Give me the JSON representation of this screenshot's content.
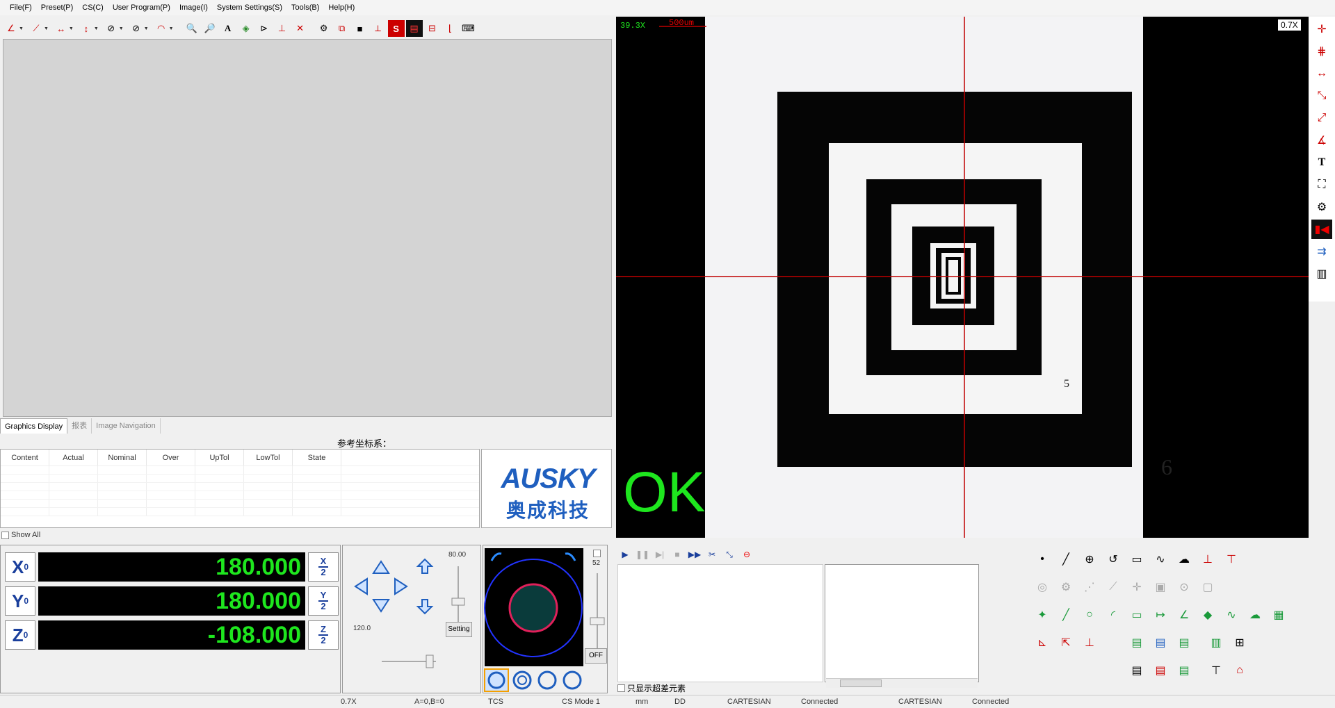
{
  "menu": [
    "File(F)",
    "Preset(P)",
    "CS(C)",
    "User Program(P)",
    "Image(I)",
    "System Settings(S)",
    "Tools(B)",
    "Help(H)"
  ],
  "tabs": [
    "Graphics Display",
    "报表",
    "Image Navigation"
  ],
  "ref_cs_label": "参考坐标系：",
  "result_table": {
    "columns": [
      "Content",
      "Actual",
      "Nominal",
      "Over",
      "UpTol",
      "LowTol",
      "State"
    ]
  },
  "logo": {
    "brand": "AUSKY",
    "cn": "奥成科技"
  },
  "show_all_label": "Show All",
  "dro": [
    {
      "axis": "X",
      "sub": "0",
      "value": "180.000",
      "half": "X",
      "den": "2"
    },
    {
      "axis": "Y",
      "sub": "0",
      "value": "180.000",
      "half": "Y",
      "den": "2"
    },
    {
      "axis": "Z",
      "sub": "0",
      "value": "-108.000",
      "half": "Z",
      "den": "2"
    }
  ],
  "jog": {
    "speed_top": "80.00",
    "speed_left": "120.0",
    "setting_label": "Setting"
  },
  "light": {
    "value": "52",
    "off_label": "OFF"
  },
  "camera": {
    "mag": "39.3X",
    "scale": "500um",
    "zoom": "0.7X",
    "result": "OK",
    "num5": "5",
    "num6": "6"
  },
  "over_only_label": "只显示超差元素",
  "status": [
    "0.7X",
    "A=0,B=0",
    "TCS",
    "CS Mode 1",
    "mm",
    "DD",
    "CARTESIAN",
    "Connected",
    "CARTESIAN",
    "Connected"
  ],
  "colors": {
    "dro_text": "#1ee61e",
    "ok_text": "#1ee61e",
    "crosshair": "#c00000",
    "logo_blue": "#1f5fbf"
  }
}
